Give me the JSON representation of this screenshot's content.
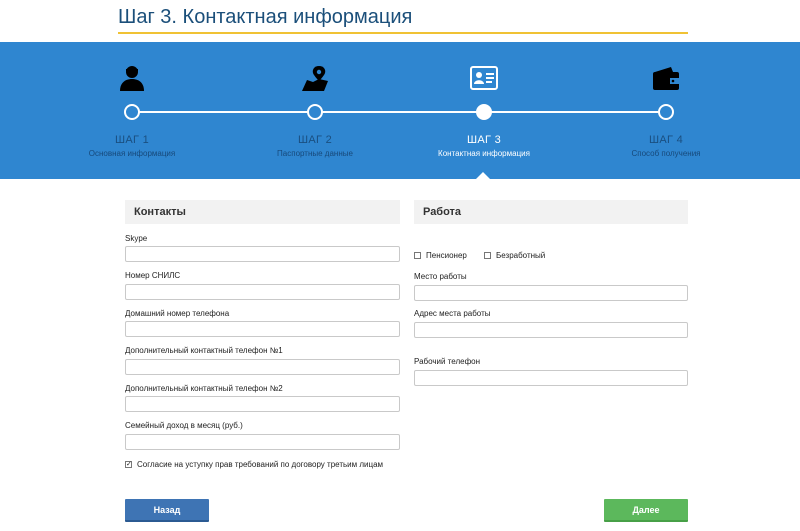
{
  "page": {
    "title": "Шаг 3. Контактная информация"
  },
  "colors": {
    "accent": "#2f86d0",
    "title_underline": "#f0c234",
    "next_button": "#5cb85c",
    "back_button": "#3e74b4"
  },
  "steps": [
    {
      "name": "ШАГ 1",
      "sub": "Основная информация",
      "icon": "person-icon",
      "active": false
    },
    {
      "name": "ШАГ 2",
      "sub": "Паспортные данные",
      "icon": "map-pin-icon",
      "active": false
    },
    {
      "name": "ШАГ 3",
      "sub": "Контактная информация",
      "icon": "id-card-icon",
      "active": true
    },
    {
      "name": "ШАГ 4",
      "sub": "Способ получения",
      "icon": "wallet-icon",
      "active": false
    }
  ],
  "contacts": {
    "header": "Контакты",
    "fields": [
      {
        "label": "Skype",
        "value": ""
      },
      {
        "label": "Номер СНИЛС",
        "value": ""
      },
      {
        "label": "Домашний номер телефона",
        "value": ""
      },
      {
        "label": "Дополнительный контактный телефон №1",
        "value": ""
      },
      {
        "label": "Дополнительный контактный телефон №2",
        "value": ""
      },
      {
        "label": "Семейный доход в месяц (руб.)",
        "value": ""
      }
    ],
    "consent": {
      "label": "Согласие на уступку прав требований по договору третьим лицам",
      "checked": true
    }
  },
  "work": {
    "header": "Работа",
    "checkboxes": [
      {
        "label": "Пенсионер",
        "checked": false
      },
      {
        "label": "Безработный",
        "checked": false
      }
    ],
    "fields": [
      {
        "label": "Место работы",
        "value": ""
      },
      {
        "label": "Адрес места работы",
        "value": ""
      },
      {
        "label": "Рабочий телефон",
        "value": ""
      }
    ]
  },
  "buttons": {
    "back": "Назад",
    "next": "Далее"
  }
}
